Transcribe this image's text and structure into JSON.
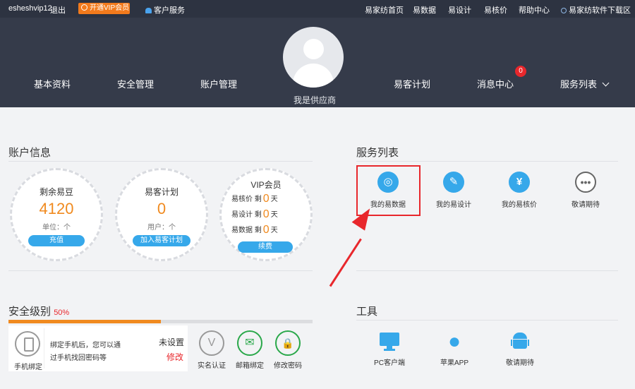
{
  "topbar": {
    "username": "esheshvip12",
    "logout": "退出",
    "vip_button": "开通VIP会员",
    "customer_service": "客户服务",
    "links": [
      "易家纺首页",
      "易数据",
      "易设计",
      "易核价",
      "帮助中心",
      "易家纺软件下载区"
    ]
  },
  "nav": {
    "left": [
      "基本资料",
      "安全管理",
      "账户管理"
    ],
    "right": [
      "易客计划",
      "消息中心",
      "服务列表"
    ],
    "message_count": "0",
    "supplier_label": "我是供应商"
  },
  "account": {
    "title": "账户信息",
    "beans": {
      "title": "剩余易豆",
      "value": "4120",
      "unit": "单位：个",
      "button": "充值"
    },
    "plan": {
      "title": "易客计划",
      "value": "0",
      "unit": "用户：个",
      "button": "加入易客计划"
    },
    "vip": {
      "title": "VIP会员",
      "rows": [
        {
          "label": "易核价 剩",
          "value": "0",
          "unit": "天"
        },
        {
          "label": "易设计 剩",
          "value": "0",
          "unit": "天"
        },
        {
          "label": "易数据 剩",
          "value": "0",
          "unit": "天"
        }
      ],
      "button": "续费"
    }
  },
  "services": {
    "title": "服务列表",
    "items": [
      {
        "label": "我的易数据",
        "icon": "data-icon"
      },
      {
        "label": "我的易设计",
        "icon": "design-icon"
      },
      {
        "label": "我的易核价",
        "icon": "price-icon"
      },
      {
        "label": "敬请期待",
        "icon": "more-icon"
      }
    ]
  },
  "security": {
    "title": "安全级别",
    "percent_label": "50%",
    "level": 0.5,
    "phone_card": {
      "label": "手机绑定",
      "desc_line1": "绑定手机后，您可以通",
      "desc_line2": "过手机找回密码等",
      "status": "未设置",
      "action": "修改"
    },
    "items": [
      {
        "label": "实名认证",
        "glyph": "V",
        "color": "#999999"
      },
      {
        "label": "邮箱绑定",
        "glyph": "✉",
        "color": "#2aa84a"
      },
      {
        "label": "修改密码",
        "glyph": "🔒",
        "color": "#2aa84a"
      }
    ]
  },
  "tools": {
    "title": "工具",
    "items": [
      {
        "label": "PC客户端",
        "icon": "monitor-icon"
      },
      {
        "label": "苹果APP",
        "icon": "apple-icon"
      },
      {
        "label": "敬请期待",
        "icon": "android-icon"
      }
    ]
  },
  "colors": {
    "accent": "#36a8ea",
    "orange": "#f08a1f",
    "red": "#e8272c",
    "header": "#353b4a"
  }
}
